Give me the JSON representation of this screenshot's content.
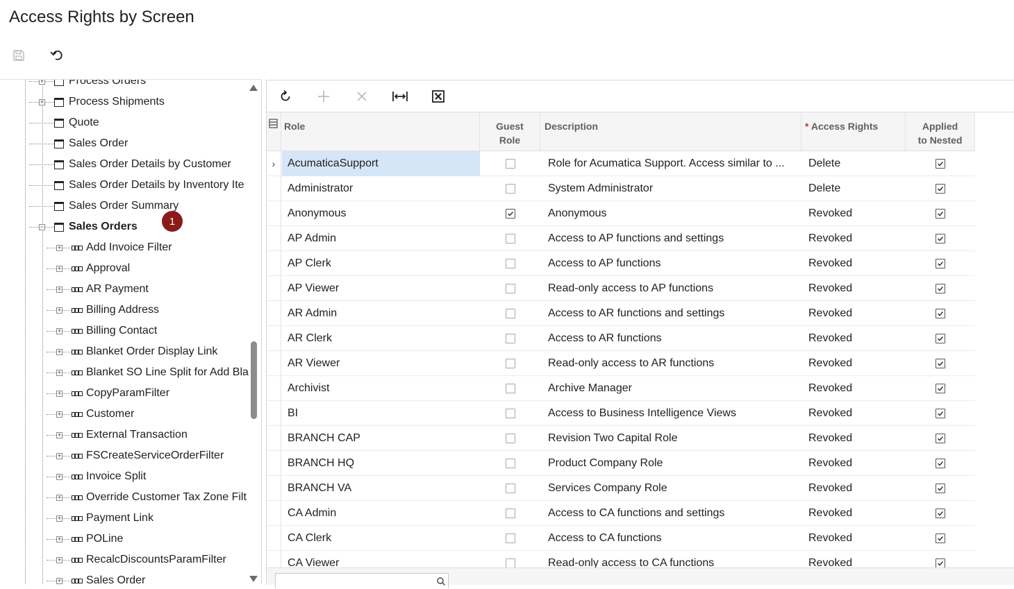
{
  "page": {
    "title": "Access Rights by Screen"
  },
  "toolbar": {
    "save_icon": "save-icon",
    "undo_icon": "undo-icon"
  },
  "tree": {
    "items": [
      {
        "label": "Process Orders",
        "kind": "screen",
        "expander": "+",
        "level": 1
      },
      {
        "label": "Process Shipments",
        "kind": "screen",
        "expander": "+",
        "level": 1
      },
      {
        "label": "Quote",
        "kind": "screen",
        "expander": "",
        "level": 1
      },
      {
        "label": "Sales Order",
        "kind": "screen",
        "expander": "",
        "level": 1
      },
      {
        "label": "Sales Order Details by Customer",
        "kind": "screen",
        "expander": "",
        "level": 1
      },
      {
        "label": "Sales Order Details by Inventory Ite",
        "kind": "screen",
        "expander": "",
        "level": 1
      },
      {
        "label": "Sales Order Summary",
        "kind": "screen",
        "expander": "",
        "level": 1
      },
      {
        "label": "Sales Orders",
        "kind": "screen",
        "expander": "−",
        "level": 1,
        "bold": true
      },
      {
        "label": "Add Invoice Filter",
        "kind": "view",
        "expander": "+",
        "level": 2
      },
      {
        "label": "Approval",
        "kind": "view",
        "expander": "+",
        "level": 2
      },
      {
        "label": "AR Payment",
        "kind": "view",
        "expander": "+",
        "level": 2
      },
      {
        "label": "Billing Address",
        "kind": "view",
        "expander": "+",
        "level": 2
      },
      {
        "label": "Billing Contact",
        "kind": "view",
        "expander": "+",
        "level": 2
      },
      {
        "label": "Blanket Order Display Link",
        "kind": "view",
        "expander": "+",
        "level": 2
      },
      {
        "label": "Blanket SO Line Split for Add Bla",
        "kind": "view",
        "expander": "+",
        "level": 2
      },
      {
        "label": "CopyParamFilter",
        "kind": "view",
        "expander": "+",
        "level": 2
      },
      {
        "label": "Customer",
        "kind": "view",
        "expander": "+",
        "level": 2
      },
      {
        "label": "External Transaction",
        "kind": "view",
        "expander": "+",
        "level": 2
      },
      {
        "label": "FSCreateServiceOrderFilter",
        "kind": "view",
        "expander": "+",
        "level": 2
      },
      {
        "label": "Invoice Split",
        "kind": "view",
        "expander": "+",
        "level": 2
      },
      {
        "label": "Override Customer Tax Zone Filt",
        "kind": "view",
        "expander": "+",
        "level": 2
      },
      {
        "label": "Payment Link",
        "kind": "view",
        "expander": "+",
        "level": 2
      },
      {
        "label": "POLine",
        "kind": "view",
        "expander": "+",
        "level": 2
      },
      {
        "label": "RecalcDiscountsParamFilter",
        "kind": "view",
        "expander": "+",
        "level": 2
      },
      {
        "label": "Sales Order",
        "kind": "view",
        "expander": "+",
        "level": 2
      }
    ],
    "marker": "1"
  },
  "grid": {
    "toolbar": {
      "refresh_icon": "refresh-icon",
      "add_icon": "add-icon",
      "delete_icon": "delete-icon",
      "fit_icon": "fit-columns-icon",
      "excel_icon": "export-excel-icon"
    },
    "columns": {
      "role": "Role",
      "guest_line1": "Guest",
      "guest_line2": "Role",
      "description": "Description",
      "required_mark": "*",
      "access_rights": "Access Rights",
      "applied_line1": "Applied",
      "applied_line2": "to Nested"
    },
    "rows": [
      {
        "role": "AcumaticaSupport",
        "guest": false,
        "description": "Role for Acumatica Support. Access similar to ...",
        "access": "Delete",
        "applied": true,
        "selected": true
      },
      {
        "role": "Administrator",
        "guest": false,
        "description": "System Administrator",
        "access": "Delete",
        "applied": true
      },
      {
        "role": "Anonymous",
        "guest": true,
        "description": "Anonymous",
        "access": "Revoked",
        "applied": true
      },
      {
        "role": "AP Admin",
        "guest": false,
        "description": "Access to AP functions and settings",
        "access": "Revoked",
        "applied": true
      },
      {
        "role": "AP Clerk",
        "guest": false,
        "description": "Access to AP functions",
        "access": "Revoked",
        "applied": true
      },
      {
        "role": "AP Viewer",
        "guest": false,
        "description": "Read-only access to AP functions",
        "access": "Revoked",
        "applied": true
      },
      {
        "role": "AR Admin",
        "guest": false,
        "description": "Access to AR functions and settings",
        "access": "Revoked",
        "applied": true
      },
      {
        "role": "AR Clerk",
        "guest": false,
        "description": "Access to AR functions",
        "access": "Revoked",
        "applied": true
      },
      {
        "role": "AR Viewer",
        "guest": false,
        "description": "Read-only access to AR functions",
        "access": "Revoked",
        "applied": true
      },
      {
        "role": "Archivist",
        "guest": false,
        "description": "Archive Manager",
        "access": "Revoked",
        "applied": true
      },
      {
        "role": "BI",
        "guest": false,
        "description": "Access to Business Intelligence Views",
        "access": "Revoked",
        "applied": true
      },
      {
        "role": "BRANCH CAP",
        "guest": false,
        "description": "Revision Two Capital Role",
        "access": "Revoked",
        "applied": true
      },
      {
        "role": "BRANCH HQ",
        "guest": false,
        "description": "Product Company Role",
        "access": "Revoked",
        "applied": true
      },
      {
        "role": "BRANCH VA",
        "guest": false,
        "description": "Services Company Role",
        "access": "Revoked",
        "applied": true
      },
      {
        "role": "CA Admin",
        "guest": false,
        "description": "Access to CA functions and settings",
        "access": "Revoked",
        "applied": true
      },
      {
        "role": "CA Clerk",
        "guest": false,
        "description": "Access to CA functions",
        "access": "Revoked",
        "applied": true
      },
      {
        "role": "CA Viewer",
        "guest": false,
        "description": "Read-only access to CA functions",
        "access": "Revoked",
        "applied": true
      }
    ],
    "search_icon": "search-icon"
  }
}
